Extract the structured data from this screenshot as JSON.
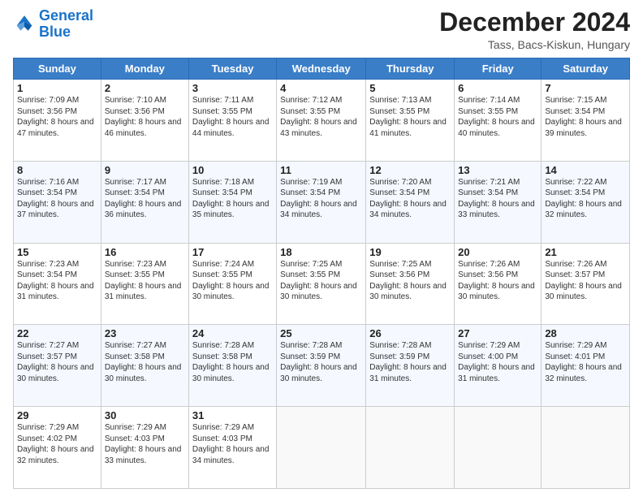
{
  "header": {
    "logo_line1": "General",
    "logo_line2": "Blue",
    "month": "December 2024",
    "location": "Tass, Bacs-Kiskun, Hungary"
  },
  "weekdays": [
    "Sunday",
    "Monday",
    "Tuesday",
    "Wednesday",
    "Thursday",
    "Friday",
    "Saturday"
  ],
  "weeks": [
    [
      {
        "day": "1",
        "sunrise": "7:09 AM",
        "sunset": "3:56 PM",
        "daylight": "8 hours and 47 minutes."
      },
      {
        "day": "2",
        "sunrise": "7:10 AM",
        "sunset": "3:56 PM",
        "daylight": "8 hours and 46 minutes."
      },
      {
        "day": "3",
        "sunrise": "7:11 AM",
        "sunset": "3:55 PM",
        "daylight": "8 hours and 44 minutes."
      },
      {
        "day": "4",
        "sunrise": "7:12 AM",
        "sunset": "3:55 PM",
        "daylight": "8 hours and 43 minutes."
      },
      {
        "day": "5",
        "sunrise": "7:13 AM",
        "sunset": "3:55 PM",
        "daylight": "8 hours and 41 minutes."
      },
      {
        "day": "6",
        "sunrise": "7:14 AM",
        "sunset": "3:55 PM",
        "daylight": "8 hours and 40 minutes."
      },
      {
        "day": "7",
        "sunrise": "7:15 AM",
        "sunset": "3:54 PM",
        "daylight": "8 hours and 39 minutes."
      }
    ],
    [
      {
        "day": "8",
        "sunrise": "7:16 AM",
        "sunset": "3:54 PM",
        "daylight": "8 hours and 37 minutes."
      },
      {
        "day": "9",
        "sunrise": "7:17 AM",
        "sunset": "3:54 PM",
        "daylight": "8 hours and 36 minutes."
      },
      {
        "day": "10",
        "sunrise": "7:18 AM",
        "sunset": "3:54 PM",
        "daylight": "8 hours and 35 minutes."
      },
      {
        "day": "11",
        "sunrise": "7:19 AM",
        "sunset": "3:54 PM",
        "daylight": "8 hours and 34 minutes."
      },
      {
        "day": "12",
        "sunrise": "7:20 AM",
        "sunset": "3:54 PM",
        "daylight": "8 hours and 34 minutes."
      },
      {
        "day": "13",
        "sunrise": "7:21 AM",
        "sunset": "3:54 PM",
        "daylight": "8 hours and 33 minutes."
      },
      {
        "day": "14",
        "sunrise": "7:22 AM",
        "sunset": "3:54 PM",
        "daylight": "8 hours and 32 minutes."
      }
    ],
    [
      {
        "day": "15",
        "sunrise": "7:23 AM",
        "sunset": "3:54 PM",
        "daylight": "8 hours and 31 minutes."
      },
      {
        "day": "16",
        "sunrise": "7:23 AM",
        "sunset": "3:55 PM",
        "daylight": "8 hours and 31 minutes."
      },
      {
        "day": "17",
        "sunrise": "7:24 AM",
        "sunset": "3:55 PM",
        "daylight": "8 hours and 30 minutes."
      },
      {
        "day": "18",
        "sunrise": "7:25 AM",
        "sunset": "3:55 PM",
        "daylight": "8 hours and 30 minutes."
      },
      {
        "day": "19",
        "sunrise": "7:25 AM",
        "sunset": "3:56 PM",
        "daylight": "8 hours and 30 minutes."
      },
      {
        "day": "20",
        "sunrise": "7:26 AM",
        "sunset": "3:56 PM",
        "daylight": "8 hours and 30 minutes."
      },
      {
        "day": "21",
        "sunrise": "7:26 AM",
        "sunset": "3:57 PM",
        "daylight": "8 hours and 30 minutes."
      }
    ],
    [
      {
        "day": "22",
        "sunrise": "7:27 AM",
        "sunset": "3:57 PM",
        "daylight": "8 hours and 30 minutes."
      },
      {
        "day": "23",
        "sunrise": "7:27 AM",
        "sunset": "3:58 PM",
        "daylight": "8 hours and 30 minutes."
      },
      {
        "day": "24",
        "sunrise": "7:28 AM",
        "sunset": "3:58 PM",
        "daylight": "8 hours and 30 minutes."
      },
      {
        "day": "25",
        "sunrise": "7:28 AM",
        "sunset": "3:59 PM",
        "daylight": "8 hours and 30 minutes."
      },
      {
        "day": "26",
        "sunrise": "7:28 AM",
        "sunset": "3:59 PM",
        "daylight": "8 hours and 31 minutes."
      },
      {
        "day": "27",
        "sunrise": "7:29 AM",
        "sunset": "4:00 PM",
        "daylight": "8 hours and 31 minutes."
      },
      {
        "day": "28",
        "sunrise": "7:29 AM",
        "sunset": "4:01 PM",
        "daylight": "8 hours and 32 minutes."
      }
    ],
    [
      {
        "day": "29",
        "sunrise": "7:29 AM",
        "sunset": "4:02 PM",
        "daylight": "8 hours and 32 minutes."
      },
      {
        "day": "30",
        "sunrise": "7:29 AM",
        "sunset": "4:03 PM",
        "daylight": "8 hours and 33 minutes."
      },
      {
        "day": "31",
        "sunrise": "7:29 AM",
        "sunset": "4:03 PM",
        "daylight": "8 hours and 34 minutes."
      },
      null,
      null,
      null,
      null
    ]
  ]
}
